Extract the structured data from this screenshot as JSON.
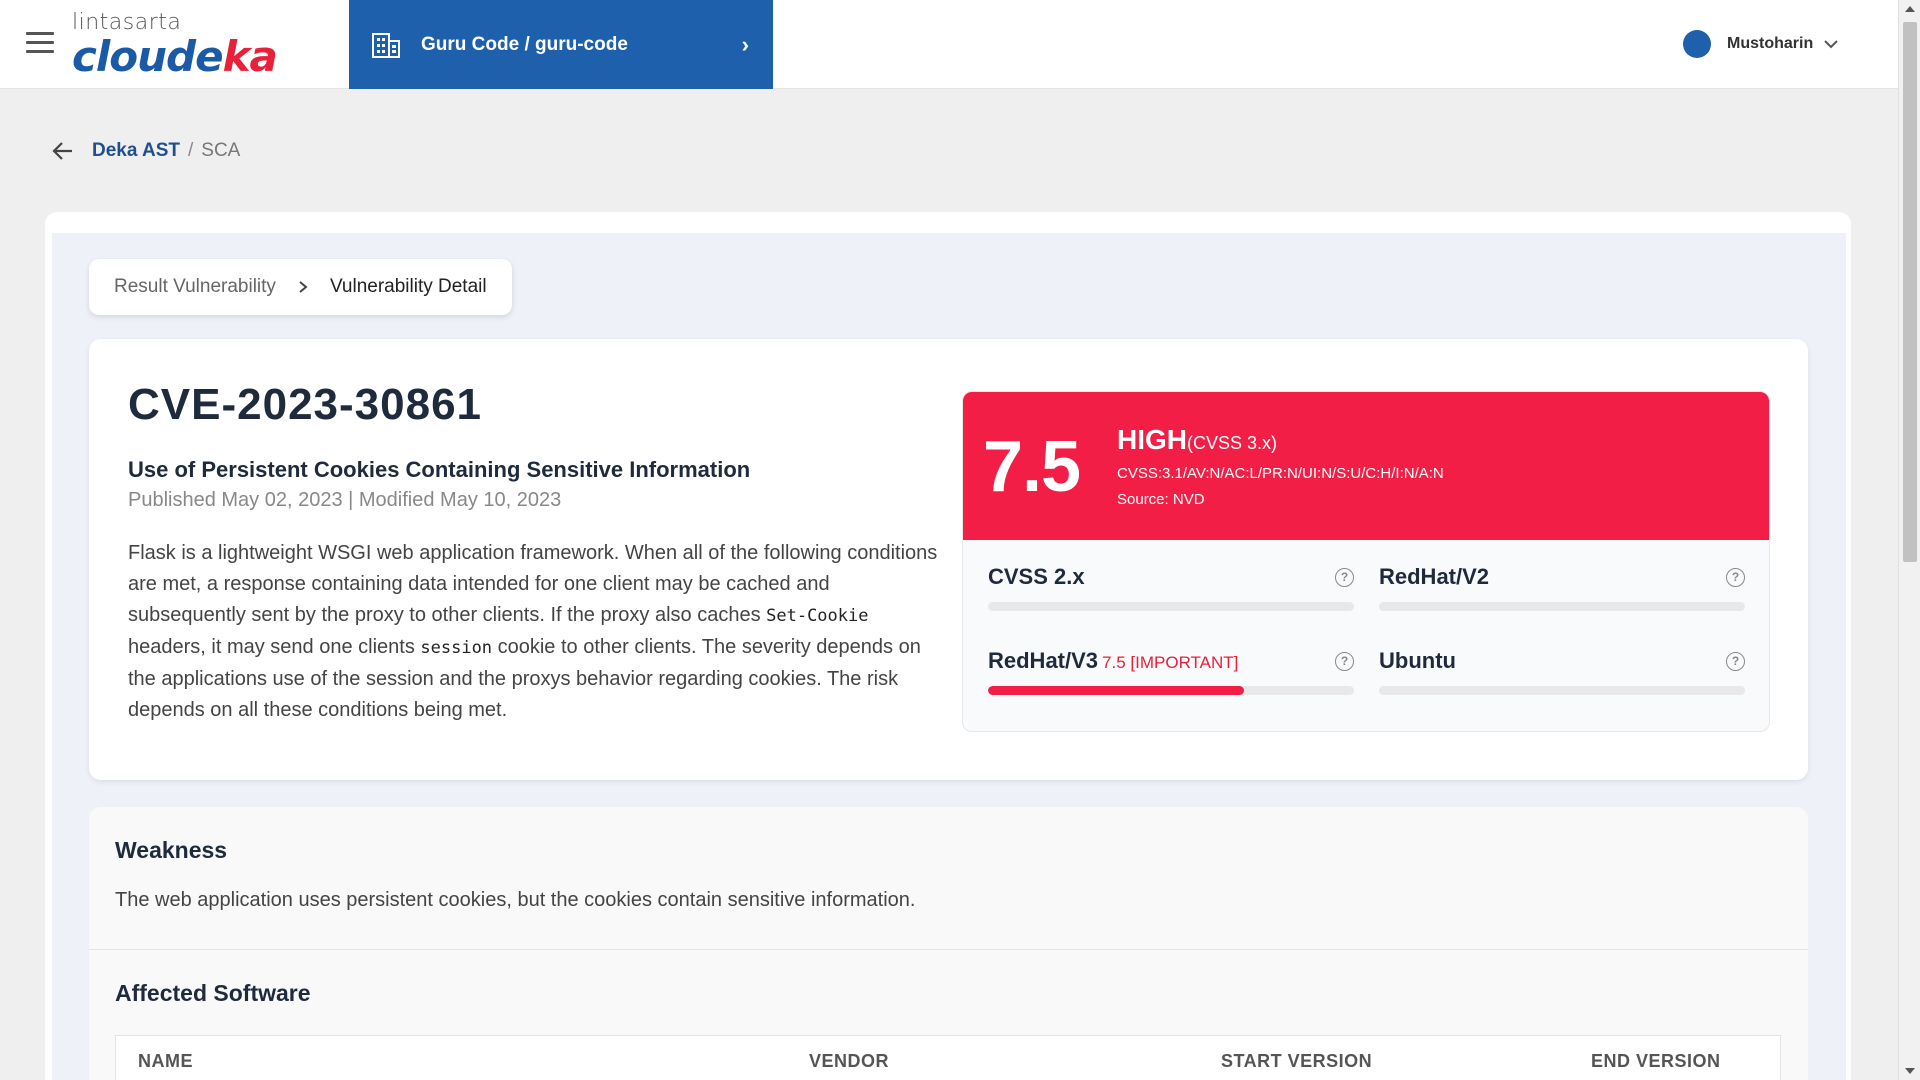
{
  "header": {
    "brand_top": "lintasarta",
    "brand_main_a": "cloude",
    "brand_main_b": "ka",
    "project_label": "Guru Code / guru-code",
    "user_name": "Mustoharin",
    "accent_color": "#1f60ac"
  },
  "breadcrumb": {
    "parent": "Deka AST",
    "separator": "/",
    "current": "SCA"
  },
  "tabs": {
    "first": "Result Vulnerability",
    "second": "Vulnerability Detail"
  },
  "cve": {
    "id": "CVE-2023-30861",
    "title": "Use of Persistent Cookies Containing Sensitive Information",
    "dates": "Published May 02, 2023 | Modified May 10, 2023",
    "desc_1": "Flask is a lightweight WSGI web application framework. When all of the following conditions are met, a response containing data intended for one client may be cached and subsequently sent by the proxy to other clients. If the proxy also caches ",
    "desc_code1": "Set-Cookie",
    "desc_2": " headers, it may send one clients ",
    "desc_code2": "session",
    "desc_3": " cookie to other clients. The severity depends on the applications use of the session and the proxys behavior regarding cookies. The risk depends on all these conditions being met."
  },
  "score": {
    "value": "7.5",
    "severity": "HIGH",
    "version": "(CVSS 3.x)",
    "vector": "CVSS:3.1/AV:N/AC:L/PR:N/UI:N/S:U/C:H/I:N/A:N",
    "source": "Source: NVD",
    "color": "#f21e45"
  },
  "metrics": [
    {
      "label": "CVSS 2.x",
      "value": "",
      "fill_fraction": 0
    },
    {
      "label": "RedHat/V2",
      "value": "",
      "fill_fraction": 0
    },
    {
      "label": "RedHat/V3",
      "value": "7.5 [IMPORTANT]",
      "fill_fraction": 0.7
    },
    {
      "label": "Ubuntu",
      "value": "",
      "fill_fraction": 0
    }
  ],
  "weakness": {
    "title": "Weakness",
    "text": "The web application uses persistent cookies, but the cookies contain sensitive information."
  },
  "affected": {
    "title": "Affected Software",
    "columns": [
      "NAME",
      "VENDOR",
      "START VERSION",
      "END VERSION"
    ]
  }
}
